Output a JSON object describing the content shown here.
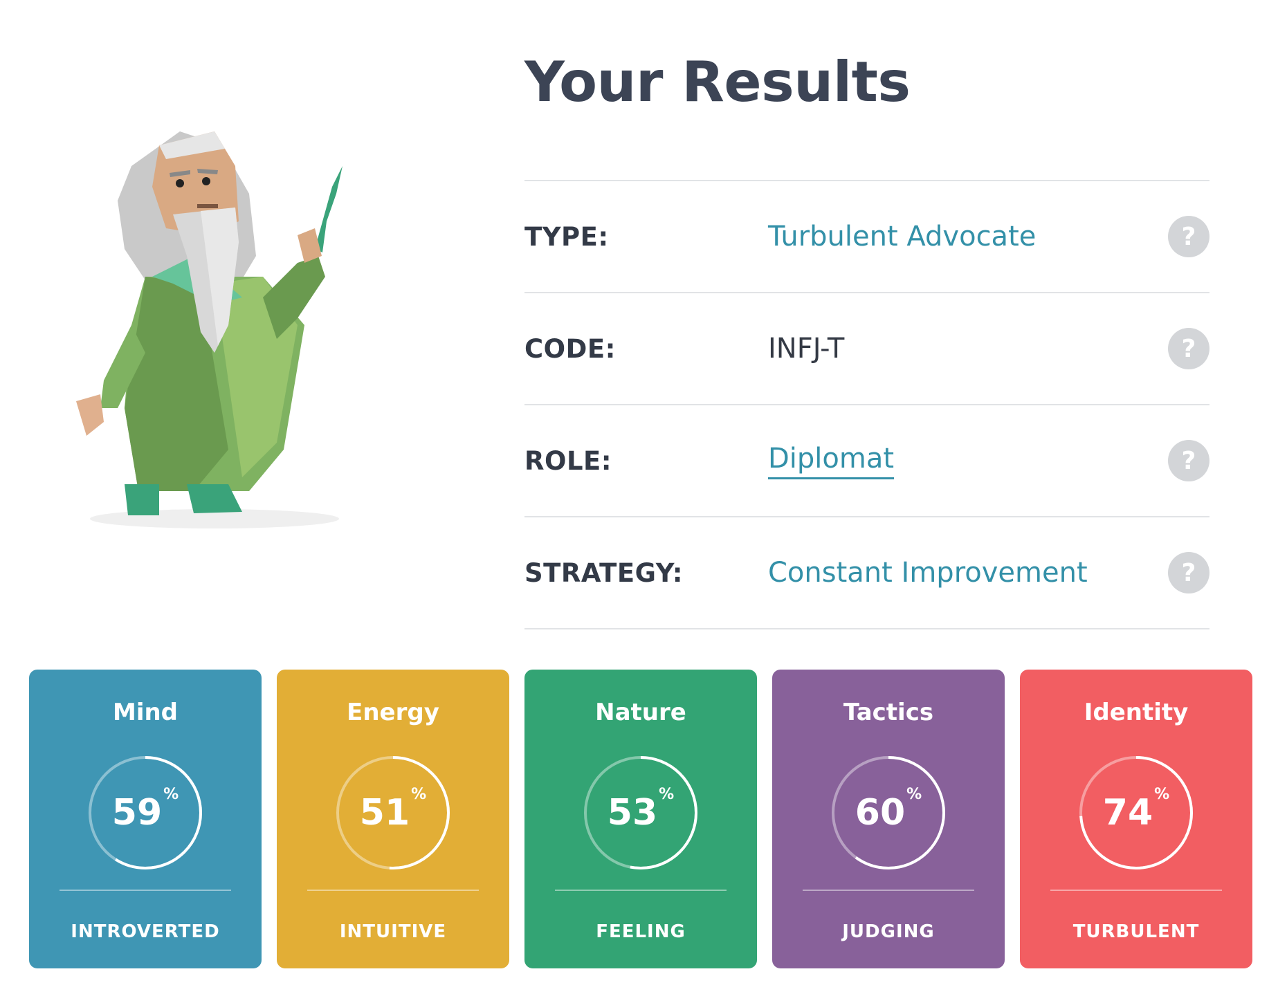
{
  "header": {
    "title": "Your Results"
  },
  "results": [
    {
      "label": "TYPE:",
      "value": "Turbulent Advocate",
      "style": "accent",
      "help": "?"
    },
    {
      "label": "CODE:",
      "value": "INFJ-T",
      "style": "dark",
      "help": "?"
    },
    {
      "label": "ROLE:",
      "value": "Diplomat",
      "style": "link",
      "help": "?"
    },
    {
      "label": "STRATEGY:",
      "value": "Constant Improvement",
      "style": "accent",
      "help": "?"
    }
  ],
  "traits": [
    {
      "title": "Mind",
      "percent": 59,
      "percent_sign": "%",
      "trait": "INTROVERTED",
      "color": "#3f96b4"
    },
    {
      "title": "Energy",
      "percent": 51,
      "percent_sign": "%",
      "trait": "INTUITIVE",
      "color": "#e2ae36"
    },
    {
      "title": "Nature",
      "percent": 53,
      "percent_sign": "%",
      "trait": "FEELING",
      "color": "#33a474"
    },
    {
      "title": "Tactics",
      "percent": 60,
      "percent_sign": "%",
      "trait": "JUDGING",
      "color": "#88619a"
    },
    {
      "title": "Identity",
      "percent": 74,
      "percent_sign": "%",
      "trait": "TURBULENT",
      "color": "#f25e62"
    }
  ],
  "colors": {
    "accent": "#3390a8",
    "heading": "#3c4455",
    "divider": "#e1e3e6",
    "help_bg": "#d3d5d8"
  },
  "illustration": {
    "icon": "wizard-advocate-illustration"
  }
}
